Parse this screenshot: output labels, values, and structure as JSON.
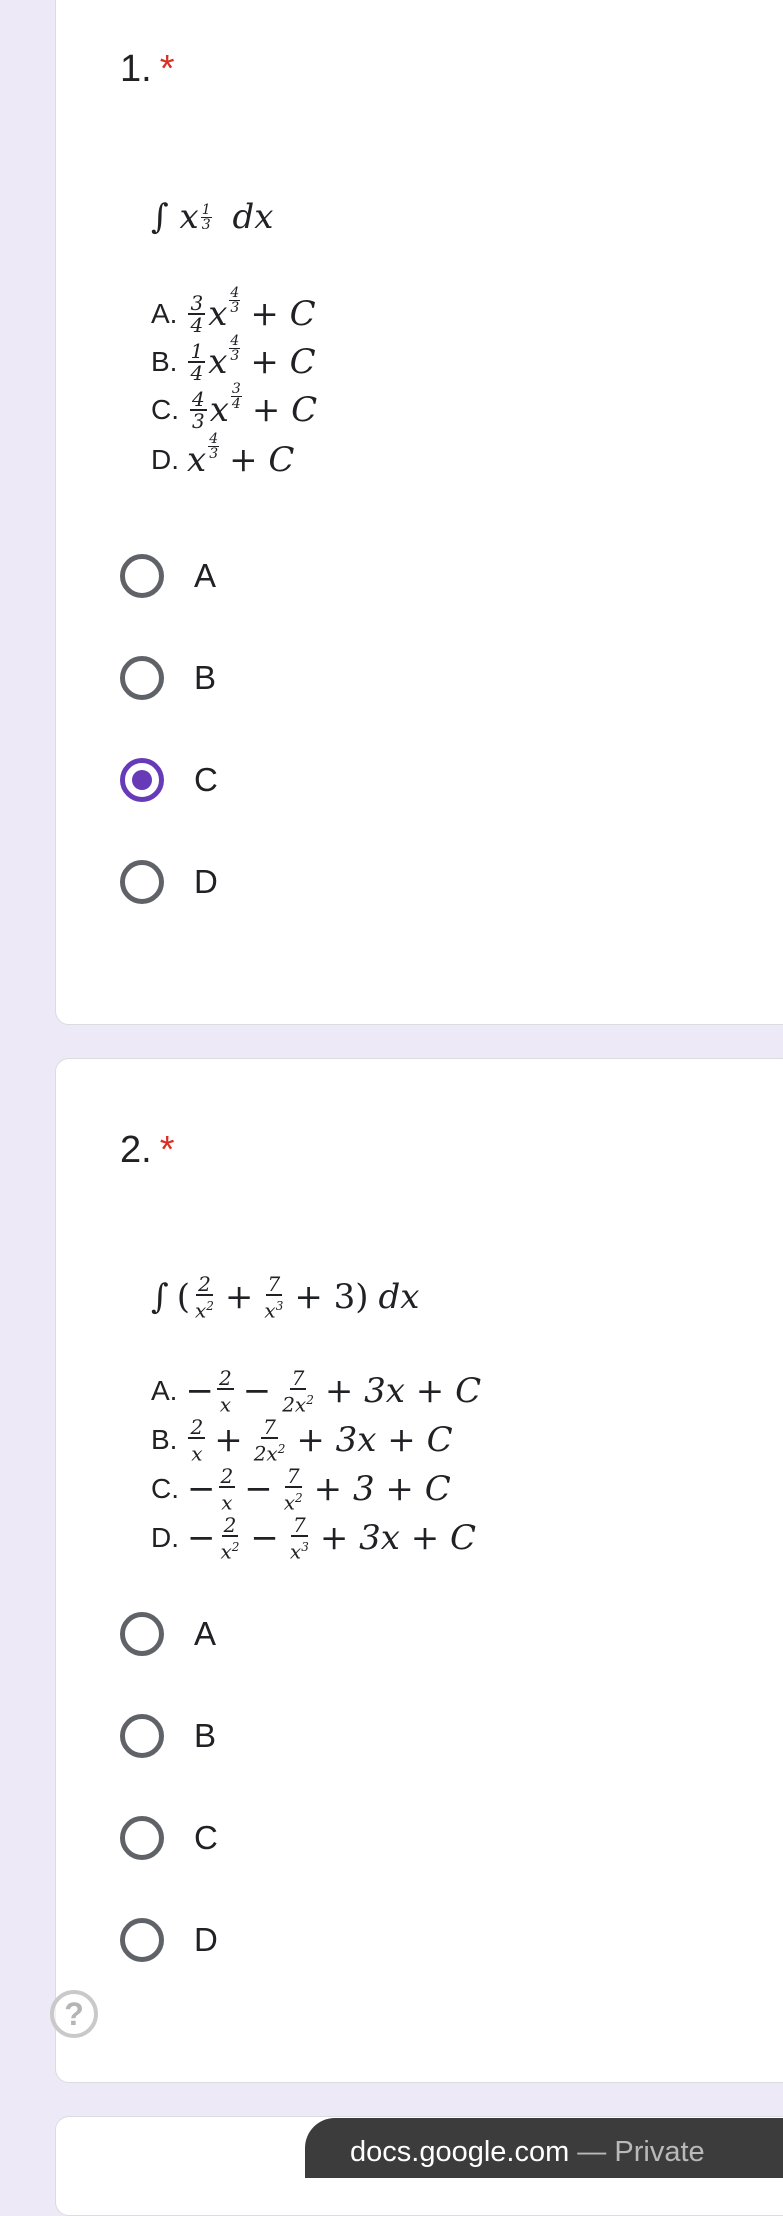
{
  "questions": [
    {
      "number": "1.",
      "required_mark": "*",
      "integral": {
        "integral_sign": "∫",
        "base": "x",
        "exp_num": "1",
        "exp_den": "3",
        "differential": "dx"
      },
      "options_text": [
        {
          "letter": "A.",
          "coef_num": "3",
          "coef_den": "4",
          "var": "x",
          "exp_num": "4",
          "exp_den": "3",
          "tail": "+ C"
        },
        {
          "letter": "B.",
          "coef_num": "1",
          "coef_den": "4",
          "var": "x",
          "exp_num": "4",
          "exp_den": "3",
          "tail": "+ C"
        },
        {
          "letter": "C.",
          "coef_num": "4",
          "coef_den": "3",
          "var": "x",
          "exp_num": "3",
          "exp_den": "4",
          "tail": "+ C"
        },
        {
          "letter": "D.",
          "var": "x",
          "exp_num": "4",
          "exp_den": "3",
          "tail": "+ C"
        }
      ],
      "choices": [
        {
          "label": "A",
          "selected": false
        },
        {
          "label": "B",
          "selected": false
        },
        {
          "label": "C",
          "selected": true
        },
        {
          "label": "D",
          "selected": false
        }
      ]
    },
    {
      "number": "2.",
      "required_mark": "*",
      "integral": {
        "integral_sign": "∫",
        "open_paren": "(",
        "t1_num": "2",
        "t1_den": "x",
        "t1_den_exp": "2",
        "plus1": "+",
        "t2_num": "7",
        "t2_den": "x",
        "t2_den_exp": "3",
        "plus2_three": "+ 3",
        "close_paren": ")",
        "differential": "dx"
      },
      "options_text": [
        {
          "letter": "A.",
          "lead": "−",
          "f1_num": "2",
          "f1_den": "x",
          "f1_den_exp": "",
          "op": "−",
          "f2_num": "7",
          "f2_den": "2x",
          "f2_den_exp": "2",
          "tail": "+ 3x + C"
        },
        {
          "letter": "B.",
          "lead": "",
          "f1_num": "2",
          "f1_den": "x",
          "f1_den_exp": "",
          "op": "+",
          "f2_num": "7",
          "f2_den": "2x",
          "f2_den_exp": "2",
          "tail": "+ 3x + C"
        },
        {
          "letter": "C.",
          "lead": "−",
          "f1_num": "2",
          "f1_den": "x",
          "f1_den_exp": "",
          "op": "−",
          "f2_num": "7",
          "f2_den": "x",
          "f2_den_exp": "2",
          "tail": "+ 3 + C"
        },
        {
          "letter": "D.",
          "lead": "−",
          "f1_num": "2",
          "f1_den": "x",
          "f1_den_exp": "2",
          "op": "−",
          "f2_num": "7",
          "f2_den": "x",
          "f2_den_exp": "3",
          "tail": "+ 3x + C"
        }
      ],
      "choices": [
        {
          "label": "A",
          "selected": false
        },
        {
          "label": "B",
          "selected": false
        },
        {
          "label": "C",
          "selected": false
        },
        {
          "label": "D",
          "selected": false
        }
      ]
    }
  ],
  "help_icon_glyph": "?",
  "url_bar": {
    "domain": "docs.google.com",
    "separator": " — ",
    "mode": "Private"
  },
  "colors": {
    "page_background": "#ede9f6",
    "accent": "#673ab7",
    "required": "#d93025"
  }
}
